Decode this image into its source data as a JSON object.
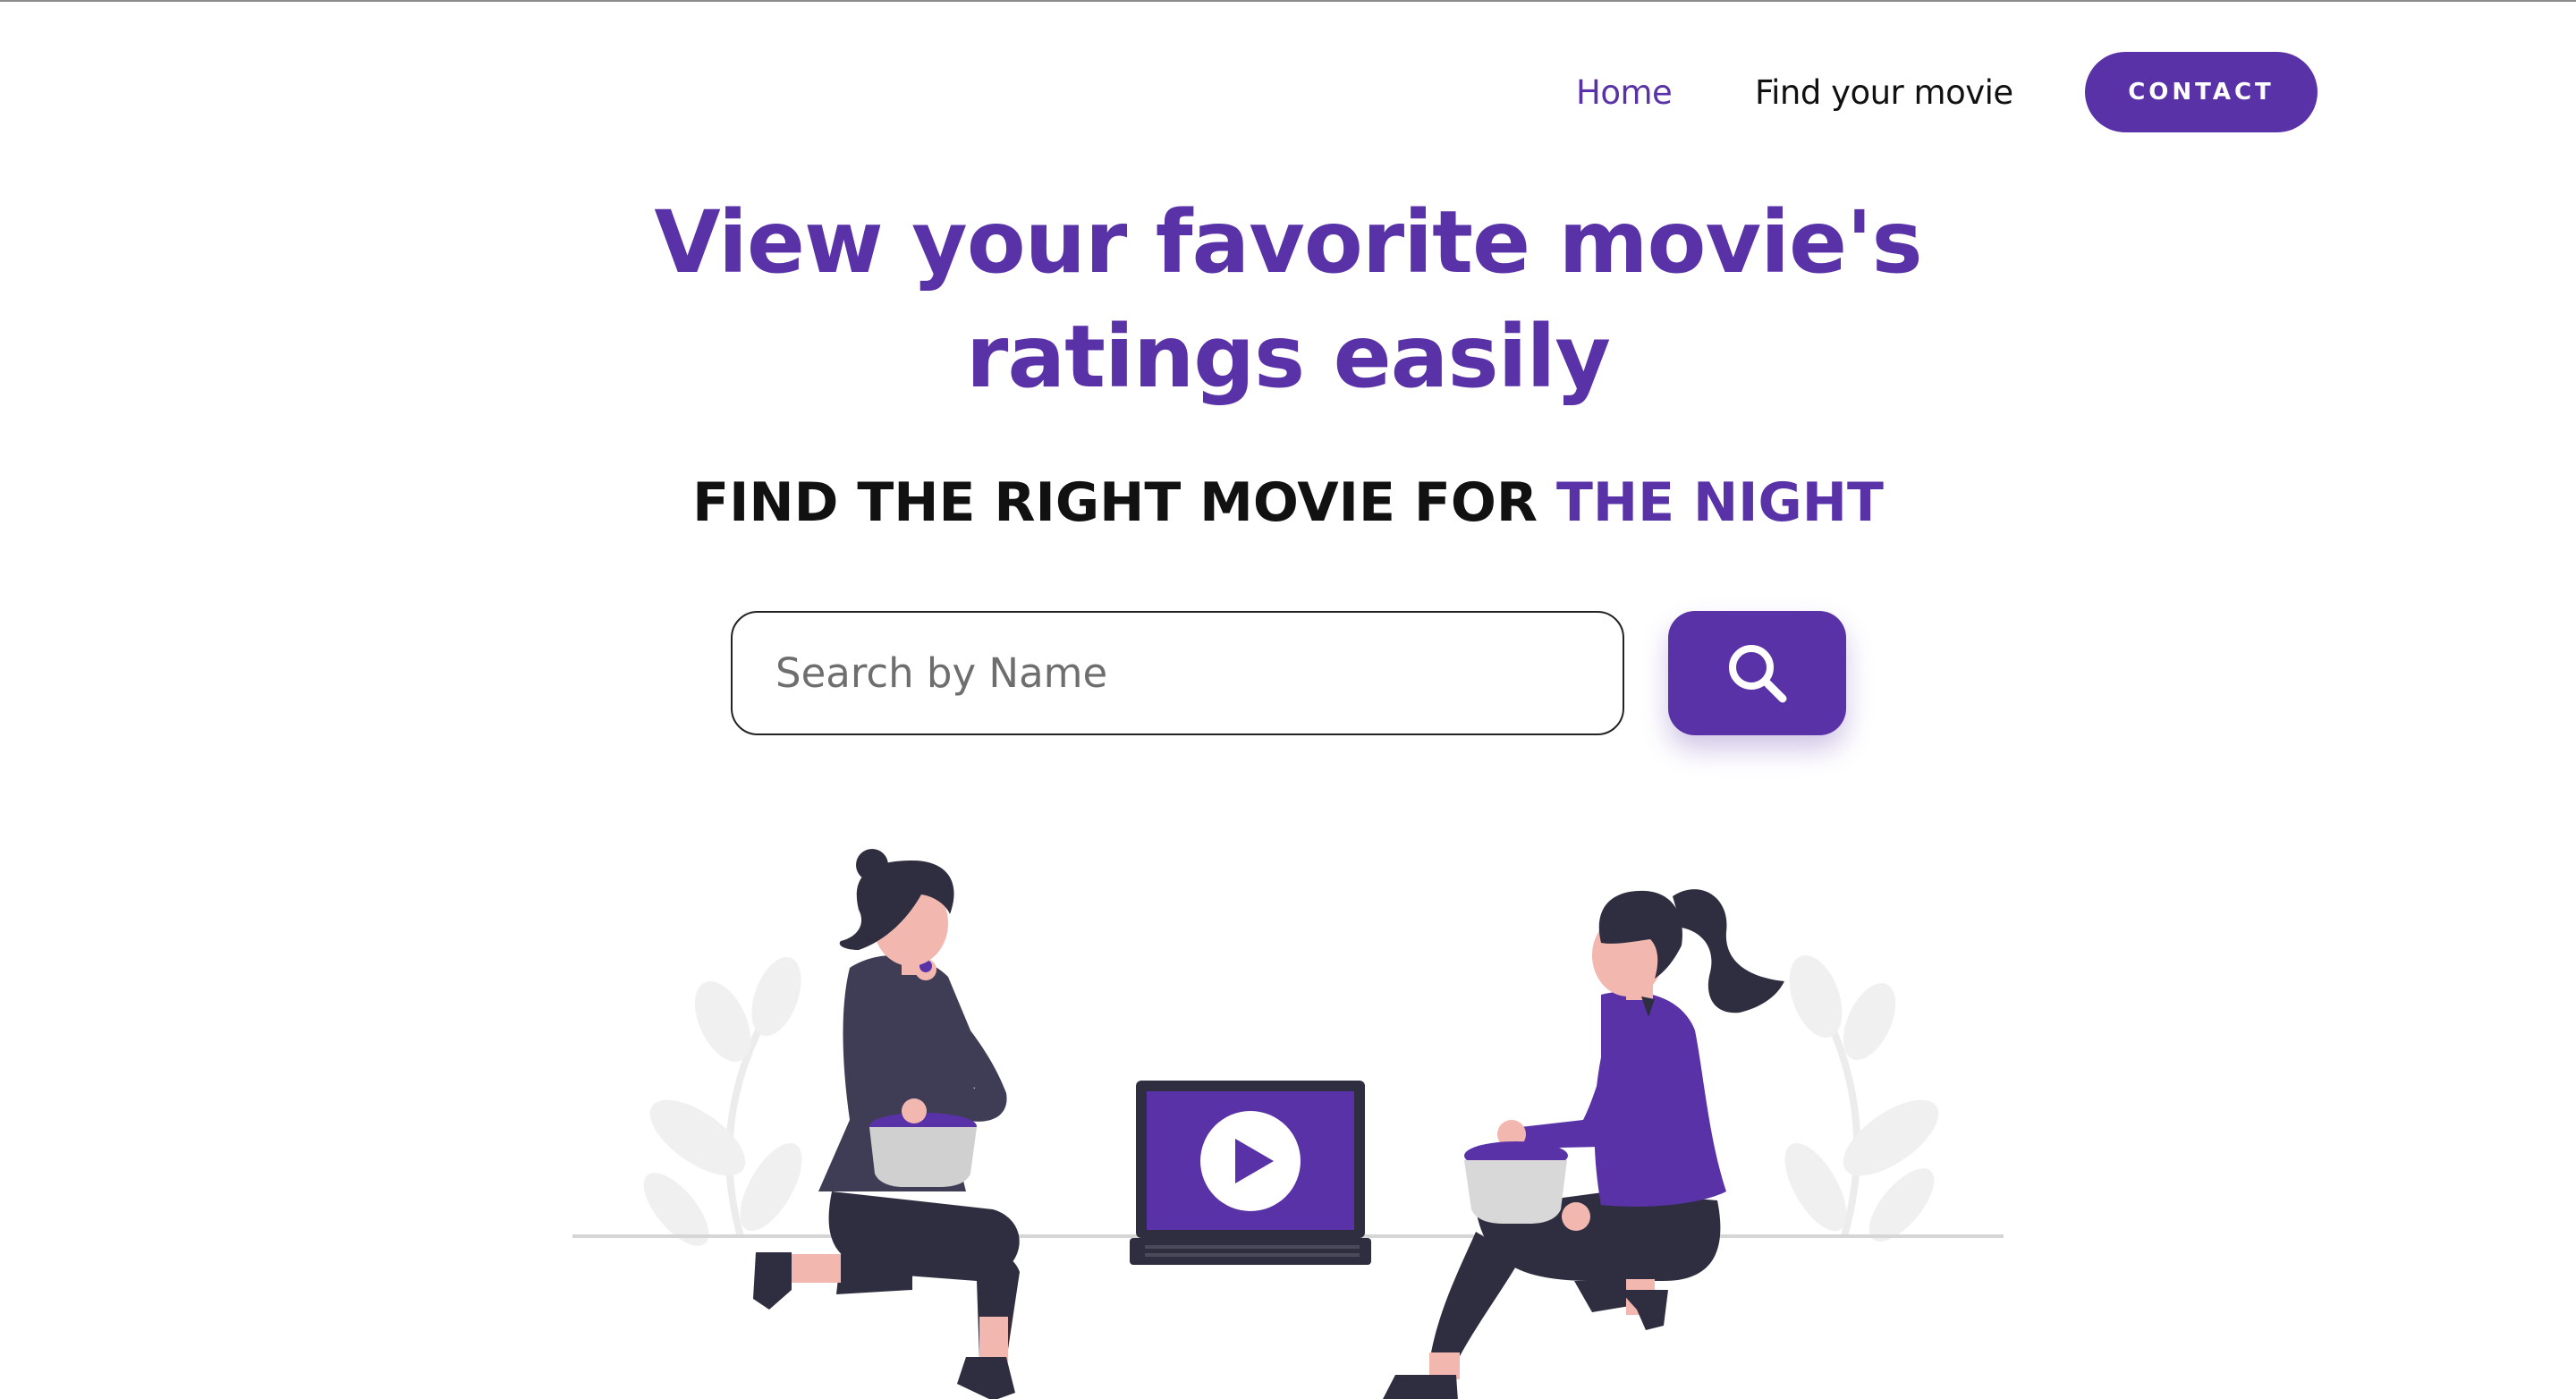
{
  "nav": {
    "home_label": "Home",
    "find_label": "Find your movie",
    "contact_label": "CONTACT"
  },
  "hero": {
    "title_line1": "View your favorite movie's",
    "title_line2": "ratings easily",
    "subtitle_main": "FIND THE RIGHT MOVIE FOR ",
    "subtitle_accent": "THE NIGHT"
  },
  "search": {
    "placeholder": "Search by Name",
    "value": "",
    "button_icon": "search-icon"
  },
  "colors": {
    "accent": "#5a32a8",
    "text": "#111111",
    "skin": "#f2b8b0",
    "dark": "#2f2e41",
    "bowl": "#d4d4d4",
    "plant": "#f0f0f0"
  }
}
